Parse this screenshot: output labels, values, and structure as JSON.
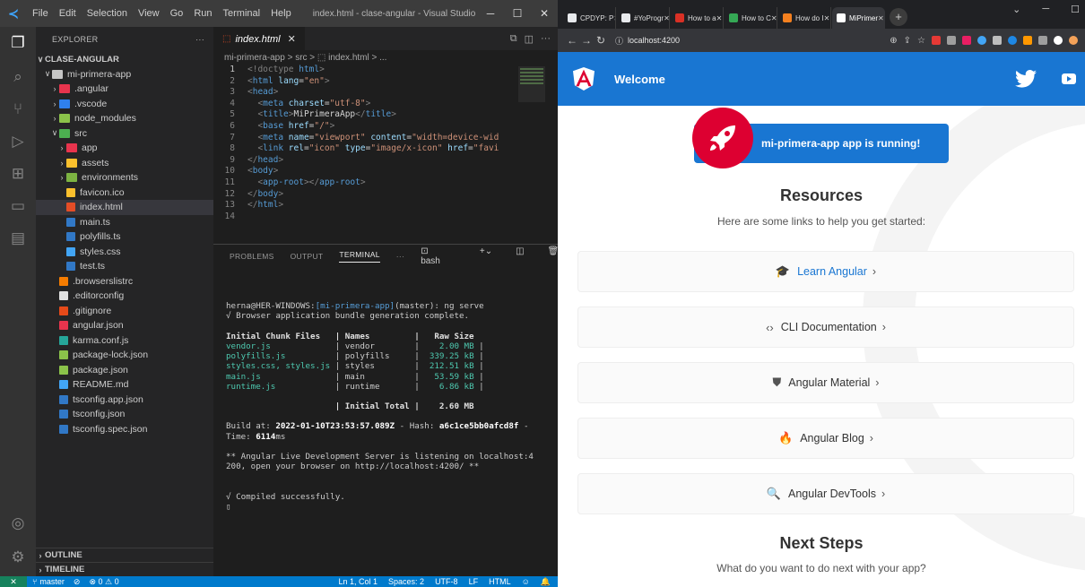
{
  "vscode": {
    "window_title": "index.html - clase-angular - Visual Studio Co...",
    "menu": [
      "File",
      "Edit",
      "Selection",
      "View",
      "Go",
      "Run",
      "Terminal",
      "Help"
    ],
    "explorer_title": "EXPLORER",
    "explorer_more": "···",
    "workspace": "CLASE-ANGULAR",
    "tree": [
      {
        "indent": 1,
        "tw": "∨",
        "label": "mi-primera-app",
        "icon": "folder-open-icon",
        "color": "#c5c5c5"
      },
      {
        "indent": 2,
        "tw": "›",
        "label": ".angular",
        "icon": "folder-angular-icon",
        "color": "#e8344d"
      },
      {
        "indent": 2,
        "tw": "›",
        "label": ".vscode",
        "icon": "folder-vscode-icon",
        "color": "#2f80ed"
      },
      {
        "indent": 2,
        "tw": "›",
        "label": "node_modules",
        "icon": "folder-node-icon",
        "color": "#8bc34a"
      },
      {
        "indent": 2,
        "tw": "∨",
        "label": "src",
        "icon": "folder-src-icon",
        "color": "#4caf50"
      },
      {
        "indent": 3,
        "tw": "›",
        "label": "app",
        "icon": "folder-app-icon",
        "color": "#e8344d"
      },
      {
        "indent": 3,
        "tw": "›",
        "label": "assets",
        "icon": "folder-assets-icon",
        "color": "#fbc02d"
      },
      {
        "indent": 3,
        "tw": "›",
        "label": "environments",
        "icon": "folder-env-icon",
        "color": "#7cb342"
      },
      {
        "indent": 3,
        "tw": "",
        "label": "favicon.ico",
        "icon": "star-icon",
        "color": "#fbc02d"
      },
      {
        "indent": 3,
        "tw": "",
        "label": "index.html",
        "icon": "html5-icon",
        "color": "#e44d26",
        "selected": true
      },
      {
        "indent": 3,
        "tw": "",
        "label": "main.ts",
        "icon": "typescript-icon",
        "color": "#3178c6"
      },
      {
        "indent": 3,
        "tw": "",
        "label": "polyfills.ts",
        "icon": "typescript-icon",
        "color": "#3178c6"
      },
      {
        "indent": 3,
        "tw": "",
        "label": "styles.css",
        "icon": "css-icon",
        "color": "#42a5f5"
      },
      {
        "indent": 3,
        "tw": "",
        "label": "test.ts",
        "icon": "typescript-icon",
        "color": "#3178c6"
      },
      {
        "indent": 2,
        "tw": "",
        "label": ".browserslistrc",
        "icon": "browserslist-icon",
        "color": "#f57c00"
      },
      {
        "indent": 2,
        "tw": "",
        "label": ".editorconfig",
        "icon": "editorconfig-icon",
        "color": "#e0e0e0"
      },
      {
        "indent": 2,
        "tw": "",
        "label": ".gitignore",
        "icon": "git-icon",
        "color": "#e64a19"
      },
      {
        "indent": 2,
        "tw": "",
        "label": "angular.json",
        "icon": "angular-icon",
        "color": "#e8344d"
      },
      {
        "indent": 2,
        "tw": "",
        "label": "karma.conf.js",
        "icon": "karma-icon",
        "color": "#26a69a"
      },
      {
        "indent": 2,
        "tw": "",
        "label": "package-lock.json",
        "icon": "npm-icon",
        "color": "#8bc34a"
      },
      {
        "indent": 2,
        "tw": "",
        "label": "package.json",
        "icon": "npm-icon",
        "color": "#8bc34a"
      },
      {
        "indent": 2,
        "tw": "",
        "label": "README.md",
        "icon": "info-icon",
        "color": "#42a5f5"
      },
      {
        "indent": 2,
        "tw": "",
        "label": "tsconfig.app.json",
        "icon": "tsconfig-icon",
        "color": "#3178c6"
      },
      {
        "indent": 2,
        "tw": "",
        "label": "tsconfig.json",
        "icon": "tsconfig-icon",
        "color": "#3178c6"
      },
      {
        "indent": 2,
        "tw": "",
        "label": "tsconfig.spec.json",
        "icon": "tsconfig-icon",
        "color": "#3178c6"
      }
    ],
    "outline": "OUTLINE",
    "timeline": "TIMELINE",
    "tab_label": "index.html",
    "breadcrumb": "mi-primera-app > src > ⬚ index.html > ...",
    "code_lines": [
      [
        {
          "t": "<!doctype ",
          "c": "#808080"
        },
        {
          "t": "html",
          "c": "#569cd6"
        },
        {
          "t": ">",
          "c": "#808080"
        }
      ],
      [
        {
          "t": "<",
          "c": "#808080"
        },
        {
          "t": "html ",
          "c": "#569cd6"
        },
        {
          "t": "lang",
          "c": "#9cdcfe"
        },
        {
          "t": "=",
          "c": "#ccc"
        },
        {
          "t": "\"en\"",
          "c": "#ce9178"
        },
        {
          "t": ">",
          "c": "#808080"
        }
      ],
      [
        {
          "t": "<",
          "c": "#808080"
        },
        {
          "t": "head",
          "c": "#569cd6"
        },
        {
          "t": ">",
          "c": "#808080"
        }
      ],
      [
        {
          "t": "  <",
          "c": "#808080"
        },
        {
          "t": "meta ",
          "c": "#569cd6"
        },
        {
          "t": "charset",
          "c": "#9cdcfe"
        },
        {
          "t": "=",
          "c": "#ccc"
        },
        {
          "t": "\"utf-8\"",
          "c": "#ce9178"
        },
        {
          "t": ">",
          "c": "#808080"
        }
      ],
      [
        {
          "t": "  <",
          "c": "#808080"
        },
        {
          "t": "title",
          "c": "#569cd6"
        },
        {
          "t": ">",
          "c": "#808080"
        },
        {
          "t": "MiPrimeraApp",
          "c": "#d4d4d4"
        },
        {
          "t": "</",
          "c": "#808080"
        },
        {
          "t": "title",
          "c": "#569cd6"
        },
        {
          "t": ">",
          "c": "#808080"
        }
      ],
      [
        {
          "t": "  <",
          "c": "#808080"
        },
        {
          "t": "base ",
          "c": "#569cd6"
        },
        {
          "t": "href",
          "c": "#9cdcfe"
        },
        {
          "t": "=",
          "c": "#ccc"
        },
        {
          "t": "\"/\"",
          "c": "#ce9178"
        },
        {
          "t": ">",
          "c": "#808080"
        }
      ],
      [
        {
          "t": "  <",
          "c": "#808080"
        },
        {
          "t": "meta ",
          "c": "#569cd6"
        },
        {
          "t": "name",
          "c": "#9cdcfe"
        },
        {
          "t": "=",
          "c": "#ccc"
        },
        {
          "t": "\"viewport\" ",
          "c": "#ce9178"
        },
        {
          "t": "content",
          "c": "#9cdcfe"
        },
        {
          "t": "=",
          "c": "#ccc"
        },
        {
          "t": "\"width=device-wid",
          "c": "#ce9178"
        }
      ],
      [
        {
          "t": "  <",
          "c": "#808080"
        },
        {
          "t": "link ",
          "c": "#569cd6"
        },
        {
          "t": "rel",
          "c": "#9cdcfe"
        },
        {
          "t": "=",
          "c": "#ccc"
        },
        {
          "t": "\"icon\" ",
          "c": "#ce9178"
        },
        {
          "t": "type",
          "c": "#9cdcfe"
        },
        {
          "t": "=",
          "c": "#ccc"
        },
        {
          "t": "\"image/x-icon\" ",
          "c": "#ce9178"
        },
        {
          "t": "href",
          "c": "#9cdcfe"
        },
        {
          "t": "=",
          "c": "#ccc"
        },
        {
          "t": "\"favi",
          "c": "#ce9178"
        }
      ],
      [
        {
          "t": "</",
          "c": "#808080"
        },
        {
          "t": "head",
          "c": "#569cd6"
        },
        {
          "t": ">",
          "c": "#808080"
        }
      ],
      [
        {
          "t": "<",
          "c": "#808080"
        },
        {
          "t": "body",
          "c": "#569cd6"
        },
        {
          "t": ">",
          "c": "#808080"
        }
      ],
      [
        {
          "t": "  <",
          "c": "#808080"
        },
        {
          "t": "app-root",
          "c": "#569cd6"
        },
        {
          "t": "></",
          "c": "#808080"
        },
        {
          "t": "app-root",
          "c": "#569cd6"
        },
        {
          "t": ">",
          "c": "#808080"
        }
      ],
      [
        {
          "t": "</",
          "c": "#808080"
        },
        {
          "t": "body",
          "c": "#569cd6"
        },
        {
          "t": ">",
          "c": "#808080"
        }
      ],
      [
        {
          "t": "</",
          "c": "#808080"
        },
        {
          "t": "html",
          "c": "#569cd6"
        },
        {
          "t": ">",
          "c": "#808080"
        }
      ],
      []
    ],
    "panel_tabs": [
      "PROBLEMS",
      "OUTPUT",
      "TERMINAL",
      "···"
    ],
    "panel_shell": "bash",
    "terminal_lines": [
      {
        "t": "",
        "c": "#ccc"
      },
      {
        "parts": [
          {
            "t": "herna@HER-WINDOWS:",
            "c": "#ccc"
          },
          {
            "t": "[mi-primera-app]",
            "c": "#569cd6"
          },
          {
            "t": "(master): ng serve",
            "c": "#ccc"
          }
        ]
      },
      {
        "t": "√ Browser application bundle generation complete.",
        "c": "#ccc"
      },
      {
        "t": "",
        "c": "#ccc"
      },
      {
        "t": "Initial Chunk Files   | Names         |   Raw Size",
        "c": "#e0e0e0",
        "b": true
      },
      {
        "parts": [
          {
            "t": "vendor.js",
            "c": "#4ec9b0"
          },
          {
            "t": "             | vendor        | ",
            "c": "#ccc"
          },
          {
            "t": "   2.00 MB",
            "c": "#4ec9b0"
          },
          {
            "t": " |",
            "c": "#ccc"
          }
        ]
      },
      {
        "parts": [
          {
            "t": "polyfills.js",
            "c": "#4ec9b0"
          },
          {
            "t": "          | polyfills     | ",
            "c": "#ccc"
          },
          {
            "t": " 339.25 kB",
            "c": "#4ec9b0"
          },
          {
            "t": " |",
            "c": "#ccc"
          }
        ]
      },
      {
        "parts": [
          {
            "t": "styles.css, styles.js",
            "c": "#4ec9b0"
          },
          {
            "t": " | styles        | ",
            "c": "#ccc"
          },
          {
            "t": " 212.51 kB",
            "c": "#4ec9b0"
          },
          {
            "t": " |",
            "c": "#ccc"
          }
        ]
      },
      {
        "parts": [
          {
            "t": "main.js",
            "c": "#4ec9b0"
          },
          {
            "t": "               | main          | ",
            "c": "#ccc"
          },
          {
            "t": "  53.59 kB",
            "c": "#4ec9b0"
          },
          {
            "t": " |",
            "c": "#ccc"
          }
        ]
      },
      {
        "parts": [
          {
            "t": "runtime.js",
            "c": "#4ec9b0"
          },
          {
            "t": "            | runtime       | ",
            "c": "#ccc"
          },
          {
            "t": "   6.86 kB",
            "c": "#4ec9b0"
          },
          {
            "t": " |",
            "c": "#ccc"
          }
        ]
      },
      {
        "t": "",
        "c": "#ccc"
      },
      {
        "t": "                      | Initial Total |    2.60 MB",
        "c": "#e0e0e0",
        "b": true
      },
      {
        "t": "",
        "c": "#ccc"
      },
      {
        "parts": [
          {
            "t": "Build at: ",
            "c": "#ccc"
          },
          {
            "t": "2022-01-10T23:53:57.089Z",
            "c": "#fff",
            "b": true
          },
          {
            "t": " - Hash: ",
            "c": "#ccc"
          },
          {
            "t": "a6c1ce5bb0afcd8f",
            "c": "#fff",
            "b": true
          },
          {
            "t": " -",
            "c": "#ccc"
          }
        ]
      },
      {
        "parts": [
          {
            "t": "Time: ",
            "c": "#ccc"
          },
          {
            "t": "6114",
            "c": "#fff",
            "b": true
          },
          {
            "t": "ms",
            "c": "#ccc"
          }
        ]
      },
      {
        "t": "",
        "c": "#ccc"
      },
      {
        "t": "** Angular Live Development Server is listening on localhost:4",
        "c": "#ccc"
      },
      {
        "t": "200, open your browser on http://localhost:4200/ **",
        "c": "#ccc"
      },
      {
        "t": "",
        "c": "#ccc"
      },
      {
        "t": "",
        "c": "#ccc"
      },
      {
        "t": "√ Compiled successfully.",
        "c": "#ccc"
      },
      {
        "t": "▯",
        "c": "#ccc"
      }
    ],
    "status": {
      "branch": "master",
      "sync": "⊘",
      "problems": "⊗ 0 ⚠ 0",
      "position": "Ln 1, Col 1",
      "spaces": "Spaces: 2",
      "encoding": "UTF-8",
      "eol": "LF",
      "language": "HTML"
    }
  },
  "chrome": {
    "tabs": [
      {
        "label": "CPDYP: P",
        "color": "#e8eaed"
      },
      {
        "label": "#YoProgr",
        "color": "#e8eaed"
      },
      {
        "label": "How to a",
        "color": "#d93025"
      },
      {
        "label": "How to C",
        "color": "#35a855"
      },
      {
        "label": "How do I",
        "color": "#f4801f"
      },
      {
        "label": "MiPrimer",
        "color": "#ffffff",
        "active": true
      }
    ],
    "url": "localhost:4200",
    "colors": {
      "toolbar": "#1976d2",
      "rocket": "#dd0031"
    }
  },
  "app": {
    "toolbar_title": "Welcome",
    "running_text": "mi-primera-app app is running!",
    "resources_title": "Resources",
    "resources_sub": "Here are some links to help you get started:",
    "cards": [
      {
        "label": "Learn Angular",
        "icon": "graduation-cap-icon",
        "glyph": "🎓",
        "link": true
      },
      {
        "label": "CLI Documentation",
        "icon": "code-brackets-icon",
        "glyph": "‹›",
        "link": false
      },
      {
        "label": "Angular Material",
        "icon": "material-shield-icon",
        "glyph": "⛊",
        "link": false
      },
      {
        "label": "Angular Blog",
        "icon": "flame-icon",
        "glyph": "🔥",
        "link": false
      },
      {
        "label": "Angular DevTools",
        "icon": "magnify-icon",
        "glyph": "🔍",
        "link": false
      }
    ],
    "next_title": "Next Steps",
    "next_sub": "What do you want to do next with your app?"
  }
}
